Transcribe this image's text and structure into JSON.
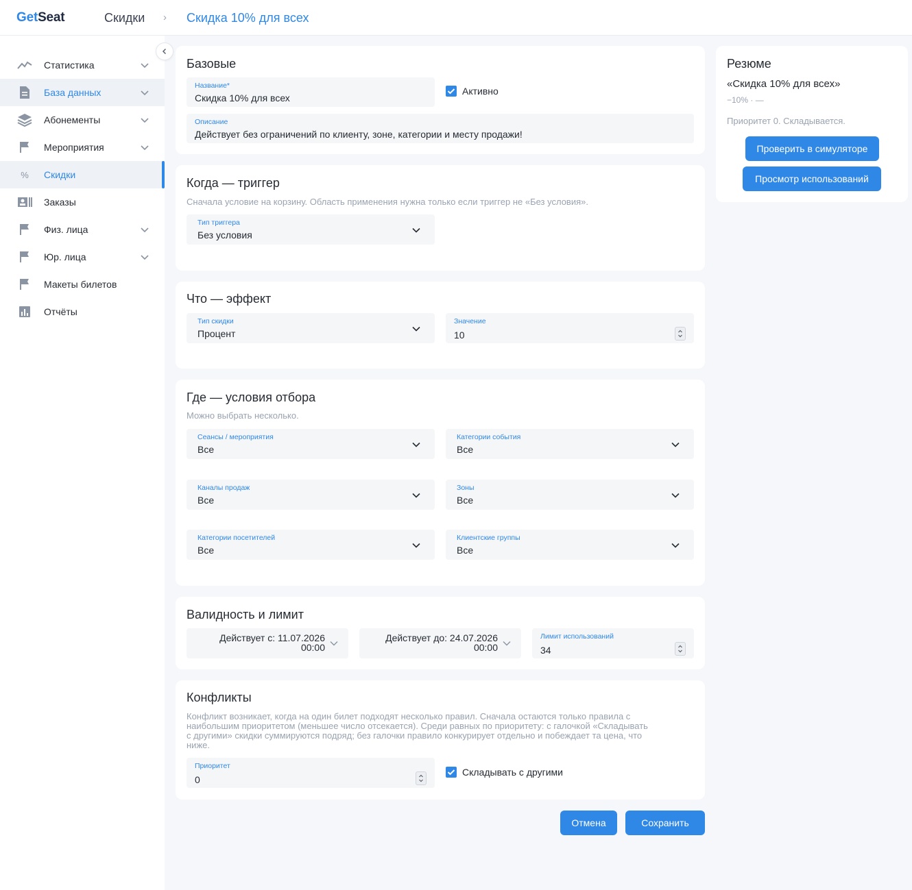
{
  "header": {
    "logo_get": "Get",
    "logo_seat": "Seat",
    "breadcrumb_parent": "Скидки",
    "breadcrumb_sep": "›",
    "breadcrumb_current": "Скидка 10% для всех"
  },
  "sidebar": {
    "items": [
      {
        "label": "Статистика",
        "icon": "chart-line-icon",
        "has_chevron": true
      },
      {
        "label": "База данных",
        "icon": "document-icon",
        "has_chevron": true
      },
      {
        "label": "Абонементы",
        "icon": "layers-icon",
        "has_chevron": true
      },
      {
        "label": "Мероприятия",
        "icon": "flag-icon",
        "has_chevron": true
      },
      {
        "label": "Скидки",
        "icon": "percent-icon",
        "has_chevron": false
      },
      {
        "label": "Заказы",
        "icon": "id-card-icon",
        "has_chevron": false
      },
      {
        "label": "Физ. лица",
        "icon": "flag-icon",
        "has_chevron": true
      },
      {
        "label": "Юр. лица",
        "icon": "flag-icon",
        "has_chevron": true
      },
      {
        "label": "Макеты билетов",
        "icon": "flag-icon",
        "has_chevron": false
      },
      {
        "label": "Отчёты",
        "icon": "bar-chart-icon",
        "has_chevron": false
      }
    ]
  },
  "basic": {
    "title": "Базовые",
    "name_label": "Название*",
    "name_value": "Скидка 10% для всех",
    "active_label": "Активно",
    "active_checked": true,
    "description_label": "Описание",
    "description_value": "Действует без ограничений по клиенту, зоне, категории и месту продажи!"
  },
  "trigger": {
    "title": "Когда — триггер",
    "hint": "Сначала условие на корзину. Область применения нужна только если триггер не «Без условия».",
    "type_label": "Тип триггера",
    "type_value": "Без условия"
  },
  "effect": {
    "title": "Что — эффект",
    "type_label": "Тип скидки",
    "type_value": "Процент",
    "value_label": "Значение",
    "value_value": "10"
  },
  "where": {
    "title": "Где — условия отбора",
    "hint": "Можно выбрать несколько.",
    "sessions_label": "Сеансы / мероприятия",
    "sessions_value": "Все",
    "event_categories_label": "Категории события",
    "event_categories_value": "Все",
    "channels_label": "Каналы продаж",
    "channels_value": "Все",
    "zones_label": "Зоны",
    "zones_value": "Все",
    "visitor_categories_label": "Категории посетителей",
    "visitor_categories_value": "Все",
    "client_groups_label": "Клиентские группы",
    "client_groups_value": "Все"
  },
  "validity": {
    "title": "Валидность и лимит",
    "from_line1": "Действует с: 11.07.2026",
    "from_line2": "00:00",
    "to_line1": "Действует до: 24.07.2026",
    "to_line2": "00:00",
    "limit_label": "Лимит использований",
    "limit_value": "34"
  },
  "conflicts": {
    "title": "Конфликты",
    "hint_line1": "Конфликт возникает, когда на один билет подходят несколько правил. Сначала остаются только правила с",
    "hint_line2": "наибольшим приоритетом (меньшее число отсекается). Среди равных по приоритету: с галочкой «Складывать",
    "hint_line3": "с другими» скидки суммируются подряд; без галочки правило конкурирует отдельно и побеждает та цена, что",
    "hint_line4": "ниже.",
    "priority_label": "Приоритет",
    "priority_value": "0",
    "stack_label": "Складывать с другими",
    "stack_checked": true
  },
  "actions": {
    "cancel": "Отмена",
    "save": "Сохранить"
  },
  "summary": {
    "title": "Резюме",
    "name": "«Скидка 10% для всех»",
    "effect": "−10% · —",
    "priority": "Приоритет 0. Складывается.",
    "simulator_button": "Проверить в симуляторе",
    "usages_button": "Просмотр использований"
  },
  "colors": {
    "accent": "#2f87e6",
    "background": "#f5f7fa",
    "field_bg": "#f5f6f8",
    "text": "#262b33",
    "hint": "#9aa3b1"
  }
}
